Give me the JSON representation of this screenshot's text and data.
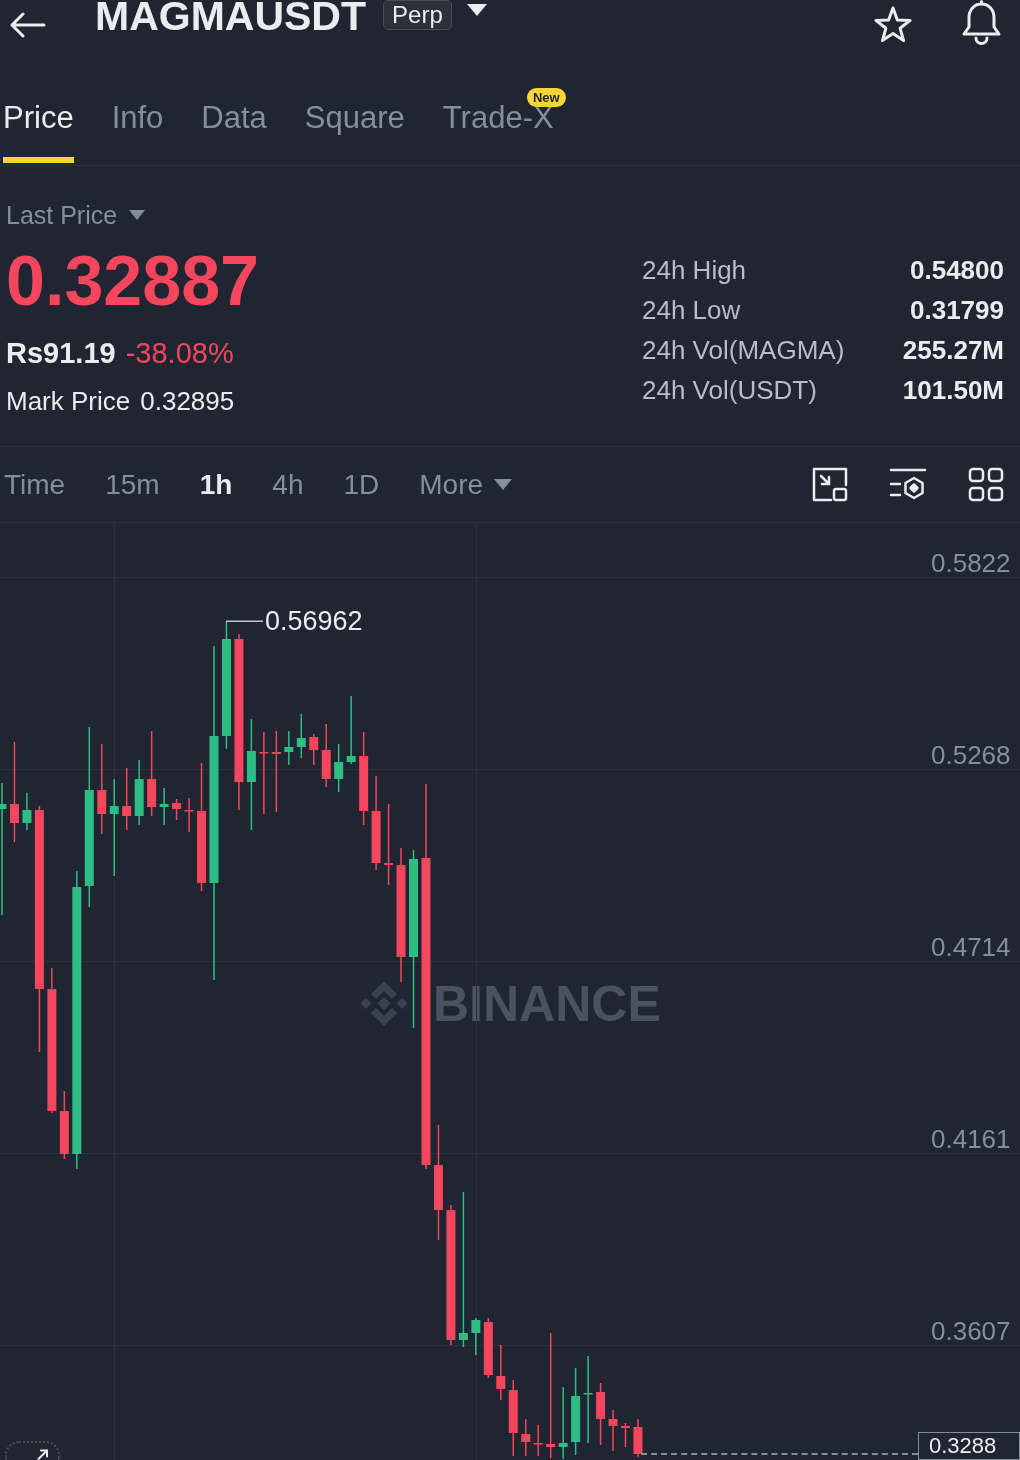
{
  "header": {
    "title": "MAGMAUSDT",
    "badge": "Perp"
  },
  "tabs": [
    {
      "label": "Price",
      "selected": true
    },
    {
      "label": "Info",
      "selected": false
    },
    {
      "label": "Data",
      "selected": false
    },
    {
      "label": "Square",
      "selected": false
    },
    {
      "label": "Trade-X",
      "selected": false,
      "badge": "New"
    }
  ],
  "price_panel": {
    "selector": "Last Price",
    "last_price": "0.32887",
    "fiat_price": "Rs91.19",
    "change": "-38.08%",
    "mark_label": "Mark Price",
    "mark_price": "0.32895"
  },
  "stats": [
    {
      "label": "24h High",
      "value": "0.54800"
    },
    {
      "label": "24h Low",
      "value": "0.31799"
    },
    {
      "label": "24h Vol(MAGMA)",
      "value": "255.27M"
    },
    {
      "label": "24h Vol(USDT)",
      "value": "101.50M"
    }
  ],
  "intervals": [
    {
      "label": "Time",
      "selected": false,
      "kind": "option"
    },
    {
      "label": "15m",
      "selected": false,
      "kind": "option"
    },
    {
      "label": "1h",
      "selected": true,
      "kind": "option"
    },
    {
      "label": "4h",
      "selected": false,
      "kind": "option"
    },
    {
      "label": "1D",
      "selected": false,
      "kind": "option"
    },
    {
      "label": "More",
      "selected": false,
      "kind": "dropdown"
    }
  ],
  "chart": {
    "price_labels": [
      "0.5822",
      "0.5268",
      "0.4714",
      "0.4161",
      "0.3607"
    ],
    "high_label": "0.56962",
    "current_price": "0.3288",
    "watermark": "BINANCE"
  }
}
